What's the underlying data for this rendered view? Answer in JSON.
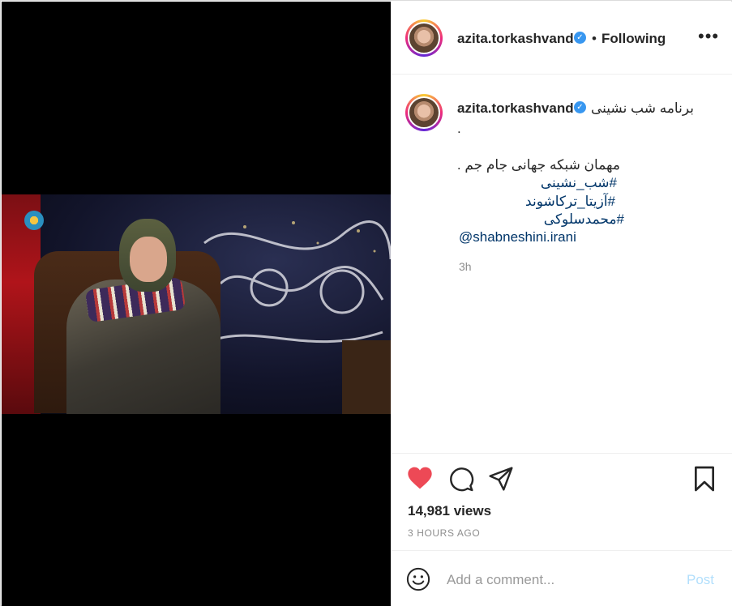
{
  "post": {
    "username": "azita.torkashvand",
    "follow_status": "Following",
    "separator": "•",
    "more_label": "•••"
  },
  "caption": {
    "username": "azita.torkashvand",
    "first_line": "برنامه شب نشینی",
    "dot_line": ".",
    "guest_line": "مهمان شبکه جهانی جام جم .",
    "hashtags": [
      "#شب_نشینی",
      "#آزیتا_ترکاشوند",
      "#محمدسلوکی"
    ],
    "mention": "@shabneshini.irani",
    "time": "3h"
  },
  "stats": {
    "views": "14,981 views",
    "time_ago": "3 HOURS AGO"
  },
  "composer": {
    "placeholder": "Add a comment...",
    "post_label": "Post"
  },
  "colors": {
    "like": "#ed4956",
    "link": "#003569",
    "verified": "#3897f0",
    "post_disabled": "#b2dffc"
  },
  "icons": [
    "verified-badge-icon",
    "more-options-icon",
    "heart-icon",
    "comment-icon",
    "share-icon",
    "bookmark-icon",
    "emoji-icon"
  ]
}
